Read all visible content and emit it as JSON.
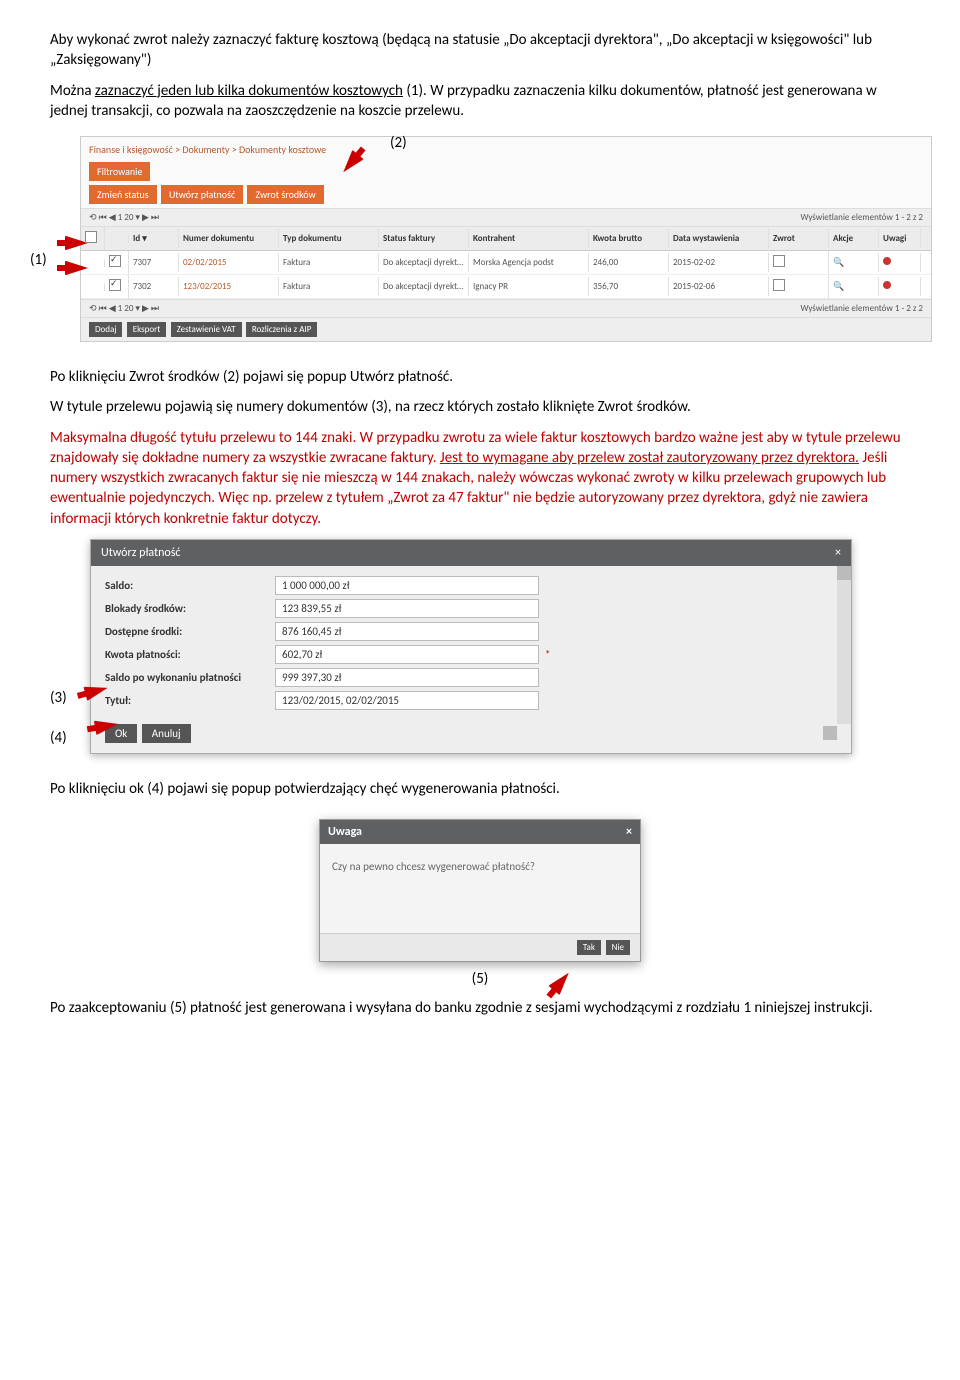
{
  "intro": {
    "p1": "Aby wykonać zwrot należy zaznaczyć fakturę kosztową (będącą na statusie „Do akceptacji dyrektora\", „Do akceptacji w księgowości\" lub „Zaksięgowany\")",
    "p2a": "Można ",
    "p2b": "zaznaczyć jeden lub kilka dokumentów kosztowych",
    "p2c": " (1). W przypadku zaznaczenia kilku dokumentów, płatność jest generowana w jednej transakcji, co pozwala na zaoszczędzenie na koszcie przelewu."
  },
  "callouts": {
    "c1": "(1)",
    "c2": "(2)",
    "c3": "(3)",
    "c4": "(4)",
    "c5": "(5)"
  },
  "gridshot": {
    "breadcrumb": "Finanse i księgowość > Dokumenty > Dokumenty kosztowe",
    "filter_btn": "Filtrowanie",
    "btns": [
      "Zmień status",
      "Utwórz płatność",
      "Zwrot środków"
    ],
    "pager_left": "⟲   ⏮ ◀  1  20 ▾  ▶ ⏭",
    "pager_right": "Wyświetlanie elementów 1 - 2 z 2",
    "head": [
      "",
      "",
      "Id ▾",
      "Numer dokumentu",
      "Typ dokumentu",
      "Status faktury",
      "Kontrahent",
      "Kwota brutto",
      "Data wystawienia",
      "Zwrot",
      "Akcje",
      "Uwagi"
    ],
    "rows": [
      {
        "chk": true,
        "id": "7307",
        "num": "02/02/2015",
        "typ": "Faktura",
        "status": "Do akceptacji dyrektora",
        "kontr": "Morska Agencja podst",
        "kwota": "246,00",
        "data": "2015-02-02"
      },
      {
        "chk": true,
        "id": "7302",
        "num": "123/02/2015",
        "typ": "Faktura",
        "status": "Do akceptacji dyrektora",
        "kontr": "Ignacy PR",
        "kwota": "356,70",
        "data": "2015-02-06"
      }
    ],
    "footer_btns": [
      "Dodaj",
      "Eksport",
      "Zestawienie VAT",
      "Rozliczenia z AIP"
    ]
  },
  "mid_text": {
    "p1": "Po kliknięciu Zwrot środków (2) pojawi się popup Utwórz płatność.",
    "p2": "W tytule przelewu pojawią się numery dokumentów (3), na rzecz których zostało kliknięte Zwrot środków.",
    "red1": "Maksymalna długość tytułu przelewu to 144 znaki. W przypadku zwrotu za wiele faktur kosztowych bardzo ważne jest aby w tytule przelewu znajdowały się dokładne numery za wszystkie zwracane faktury. ",
    "red1u": "Jest to wymagane aby przelew został zautoryzowany przez dyrektora.",
    "red2": " Jeśli numery wszystkich zwracanych faktur się nie mieszczą w 144 znakach, należy wówczas wykonać zwroty w kilku przelewach grupowych lub ewentualnie pojedynczych. Więc np. przelew z tytułem „Zwrot za 47 faktur\" nie będzie autoryzowany przez dyrektora, gdyż nie zawiera informacji których konkretnie faktur dotyczy."
  },
  "dialog": {
    "title": "Utwórz płatność",
    "close": "×",
    "fields": [
      {
        "label": "Saldo:",
        "value": "1 000 000,00 zł"
      },
      {
        "label": "Blokady środków:",
        "value": "123 839,55 zł"
      },
      {
        "label": "Dostępne środki:",
        "value": "876 160,45 zł"
      },
      {
        "label": "Kwota płatności:",
        "value": "602,70 zł",
        "req": true
      },
      {
        "label": "Saldo po wykonaniu płatności",
        "value": "999 397,30 zł"
      },
      {
        "label": "Tytuł:",
        "value": "123/02/2015, 02/02/2015"
      }
    ],
    "ok": "Ok",
    "cancel": "Anuluj"
  },
  "after_dialog": "Po kliknięciu ok (4) pojawi się popup potwierdzający chęć wygenerowania płatności.",
  "confirm": {
    "title": "Uwaga",
    "close": "×",
    "msg": "Czy na pewno chcesz wygenerować płatność?",
    "yes": "Tak",
    "no": "Nie"
  },
  "after_confirm": "Po zaakceptowaniu (5) płatność jest generowana i wysyłana do banku zgodnie z sesjami wychodzącymi z rozdziału 1 niniejszej instrukcji."
}
